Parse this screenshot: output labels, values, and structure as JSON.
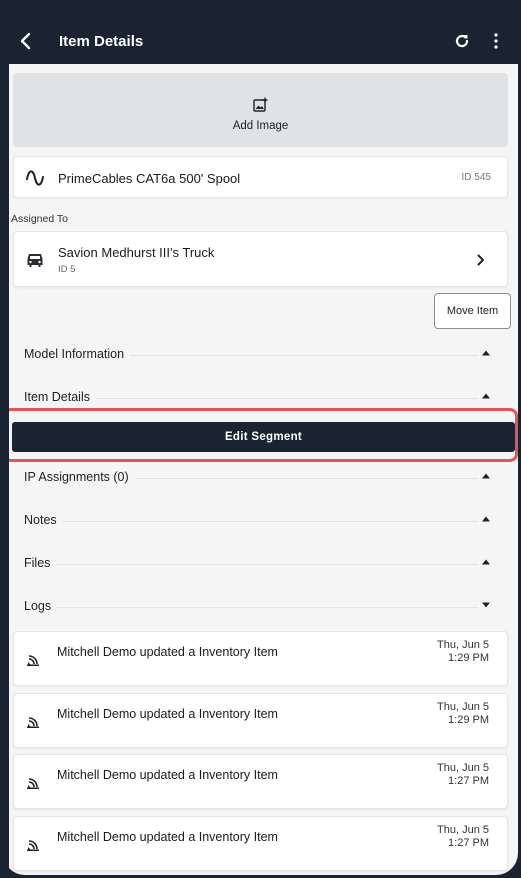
{
  "header": {
    "title": "Item Details"
  },
  "add_image": {
    "label": "Add Image"
  },
  "product": {
    "name": "PrimeCables CAT6a 500' Spool",
    "id": "ID 545"
  },
  "assigned": {
    "label": "Assigned To",
    "name": "Savion Medhurst III's Truck",
    "id": "ID 5"
  },
  "move_button": "Move Item",
  "sections": {
    "model_info": "Model Information",
    "item_details": "Item Details",
    "ip_assignments": "IP Assignments (0)",
    "notes": "Notes",
    "files": "Files",
    "logs": "Logs"
  },
  "edit_segment": "Edit Segment",
  "logs": [
    {
      "text": "Mitchell Demo updated a Inventory Item",
      "date": "Thu, Jun 5",
      "time": "1:29 PM"
    },
    {
      "text": "Mitchell Demo updated a Inventory Item",
      "date": "Thu, Jun 5",
      "time": "1:29 PM"
    },
    {
      "text": "Mitchell Demo updated a Inventory Item",
      "date": "Thu, Jun 5",
      "time": "1:27 PM"
    },
    {
      "text": "Mitchell Demo updated a Inventory Item",
      "date": "Thu, Jun 5",
      "time": "1:27 PM"
    }
  ],
  "colors": {
    "header": "#1a2332",
    "highlight": "#e45555",
    "background": "#f5f5f6"
  }
}
